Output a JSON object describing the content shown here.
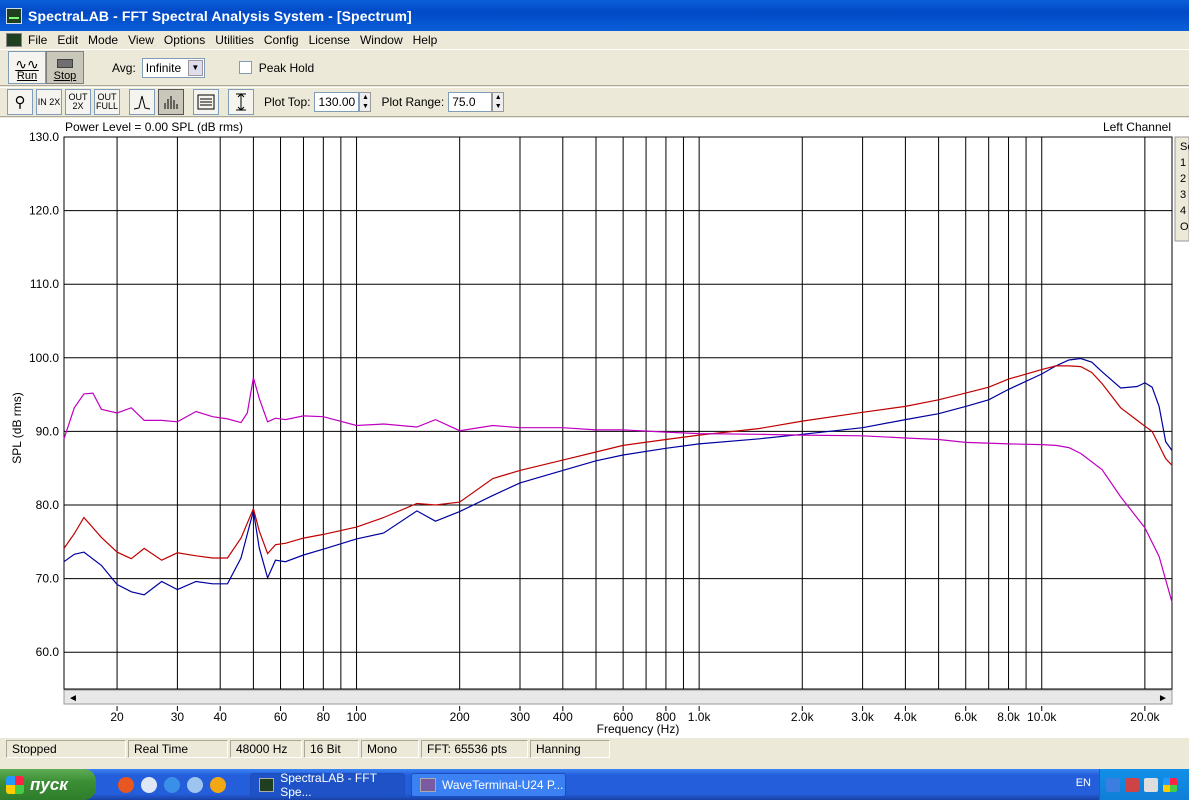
{
  "window": {
    "title": "SpectraLAB - FFT Spectral Analysis System - [Spectrum]"
  },
  "menu": [
    "File",
    "Edit",
    "Mode",
    "View",
    "Options",
    "Utilities",
    "Config",
    "License",
    "Window",
    "Help"
  ],
  "toolbar1": {
    "run_label": "Run",
    "stop_label": "Stop",
    "avg_label": "Avg:",
    "avg_value": "Infinite",
    "peak_hold_label": "Peak Hold",
    "peak_hold_checked": false
  },
  "toolbar2": {
    "tools": [
      {
        "name": "zoom-tool-button",
        "label": "",
        "pressed": false
      },
      {
        "name": "zoom-in-2x-button",
        "label": "IN 2X",
        "pressed": false
      },
      {
        "name": "zoom-out-2x-button",
        "label": "OUT 2X",
        "pressed": false
      },
      {
        "name": "zoom-out-full-button",
        "label": "OUT FULL",
        "pressed": false
      },
      {
        "name": "line-plot-button",
        "label": "",
        "pressed": false
      },
      {
        "name": "bar-plot-button",
        "label": "",
        "pressed": true
      },
      {
        "name": "overlay-button",
        "label": "",
        "pressed": false
      },
      {
        "name": "autoscale-button",
        "label": "",
        "pressed": false
      }
    ],
    "plot_top_label": "Plot Top:",
    "plot_top_value": "130.00",
    "plot_range_label": "Plot Range:",
    "plot_range_value": "75.0"
  },
  "plot": {
    "power_level": "Power Level = 0.00 SPL (dB rms)",
    "channel": "Left Channel",
    "side_tabs": [
      "Set",
      "1",
      "2",
      "3",
      "4",
      "O"
    ]
  },
  "chart_data": {
    "type": "line",
    "xlabel": "Frequency (Hz)",
    "ylabel": "SPL (dB rms)",
    "xscale": "log",
    "xlim": [
      14,
      24000
    ],
    "ylim": [
      55,
      130
    ],
    "y_ticks": [
      60,
      70,
      80,
      90,
      100,
      110,
      120,
      130
    ],
    "y_tick_labels": [
      "60.0",
      "70.0",
      "80.0",
      "90.0",
      "100.0",
      "110.0",
      "120.0",
      "130.0"
    ],
    "x_ticks": [
      20,
      30,
      40,
      60,
      80,
      100,
      200,
      300,
      400,
      600,
      800,
      1000,
      2000,
      3000,
      4000,
      6000,
      8000,
      10000,
      20000
    ],
    "x_tick_labels": [
      "20",
      "30",
      "40",
      "60",
      "80",
      "100",
      "200",
      "300",
      "400",
      "600",
      "800",
      "1.0k",
      "2.0k",
      "3.0k",
      "4.0k",
      "6.0k",
      "8.0k",
      "10.0k",
      "20.0k"
    ],
    "x_gridlines": [
      20,
      30,
      40,
      50,
      60,
      70,
      80,
      90,
      100,
      200,
      300,
      400,
      500,
      600,
      700,
      800,
      900,
      1000,
      2000,
      3000,
      4000,
      5000,
      6000,
      7000,
      8000,
      9000,
      10000,
      20000
    ],
    "series": [
      {
        "color": "#0000a0",
        "x": [
          14,
          15,
          16,
          18,
          20,
          22,
          24,
          27,
          30,
          34,
          38,
          42,
          46,
          50,
          52,
          55,
          58,
          62,
          70,
          80,
          100,
          120,
          150,
          170,
          200,
          250,
          300,
          400,
          500,
          600,
          800,
          1000,
          1500,
          2000,
          3000,
          4000,
          5000,
          6000,
          7000,
          8000,
          10000,
          11000,
          12000,
          13000,
          14000,
          15000,
          17000,
          19000,
          20000,
          21000,
          22000,
          23000,
          24000
        ],
        "y": [
          72.3,
          73.3,
          73.6,
          71.8,
          69.2,
          68.2,
          67.8,
          69.6,
          68.5,
          69.6,
          69.3,
          69.3,
          72.8,
          79.2,
          74.2,
          70.1,
          72.5,
          72.3,
          73.2,
          74.0,
          75.4,
          76.2,
          79.2,
          77.8,
          79.1,
          81.3,
          83.0,
          84.7,
          86.0,
          86.8,
          87.7,
          88.3,
          89.0,
          89.6,
          90.5,
          91.6,
          92.4,
          93.4,
          94.3,
          95.7,
          97.8,
          98.9,
          99.7,
          99.9,
          99.4,
          98.1,
          95.9,
          96.1,
          96.6,
          96.0,
          93.4,
          88.6,
          87.4
        ]
      },
      {
        "color": "#c00000",
        "x": [
          14,
          15,
          16,
          18,
          20,
          22,
          24,
          27,
          30,
          34,
          38,
          42,
          46,
          50,
          52,
          55,
          58,
          62,
          70,
          80,
          100,
          120,
          150,
          170,
          200,
          250,
          300,
          400,
          500,
          600,
          800,
          1000,
          1500,
          2000,
          3000,
          4000,
          5000,
          6000,
          7000,
          8000,
          10000,
          11000,
          12000,
          13000,
          14000,
          15000,
          17000,
          19000,
          20000,
          21000,
          22000,
          23000,
          24000
        ],
        "y": [
          74.1,
          76.1,
          78.3,
          75.6,
          73.6,
          72.7,
          74.1,
          72.5,
          73.5,
          73.1,
          72.8,
          72.8,
          75.5,
          79.5,
          76.5,
          73.4,
          74.6,
          74.8,
          75.5,
          76.0,
          77.0,
          78.3,
          80.2,
          80.0,
          80.4,
          83.6,
          84.7,
          86.1,
          87.2,
          88.1,
          88.9,
          89.5,
          90.4,
          91.4,
          92.6,
          93.4,
          94.3,
          95.2,
          96.0,
          97.1,
          98.4,
          98.9,
          98.9,
          98.8,
          98.0,
          96.5,
          93.2,
          91.5,
          90.7,
          90.0,
          88.1,
          86.3,
          85.4
        ]
      },
      {
        "color": "#c000c0",
        "x": [
          14,
          15,
          16,
          17,
          18,
          20,
          22,
          24,
          27,
          30,
          34,
          38,
          42,
          46,
          48,
          50,
          52,
          55,
          58,
          62,
          70,
          80,
          100,
          120,
          150,
          170,
          200,
          250,
          300,
          400,
          500,
          600,
          800,
          1000,
          1500,
          2000,
          3000,
          4000,
          5000,
          6000,
          8000,
          10000,
          11000,
          12000,
          13000,
          15000,
          17000,
          20000,
          22000,
          24000
        ],
        "y": [
          89.0,
          93.2,
          95.1,
          95.2,
          93.0,
          92.5,
          93.2,
          91.5,
          91.5,
          91.3,
          92.7,
          92.0,
          91.7,
          91.2,
          92.5,
          97.3,
          94.5,
          91.3,
          91.8,
          91.6,
          92.1,
          92.0,
          90.8,
          91.0,
          90.6,
          91.6,
          90.1,
          90.8,
          90.5,
          90.5,
          90.2,
          90.2,
          89.9,
          89.7,
          89.6,
          89.5,
          89.4,
          89.1,
          88.9,
          88.5,
          88.3,
          88.2,
          88.1,
          87.8,
          87.0,
          84.8,
          81.1,
          76.9,
          73.0,
          66.8
        ]
      }
    ]
  },
  "status": {
    "state": "Stopped",
    "mode": "Real Time",
    "rate": "48000 Hz",
    "bits": "16 Bit",
    "channels": "Mono",
    "fft": "FFT: 65536 pts",
    "window": "Hanning"
  },
  "taskbar": {
    "start_label": "пуск",
    "tasks": [
      {
        "label": "SpectraLAB - FFT Spe...",
        "active": true
      },
      {
        "label": "WaveTerminal-U24 P...",
        "active": false
      }
    ],
    "lang": "EN"
  }
}
